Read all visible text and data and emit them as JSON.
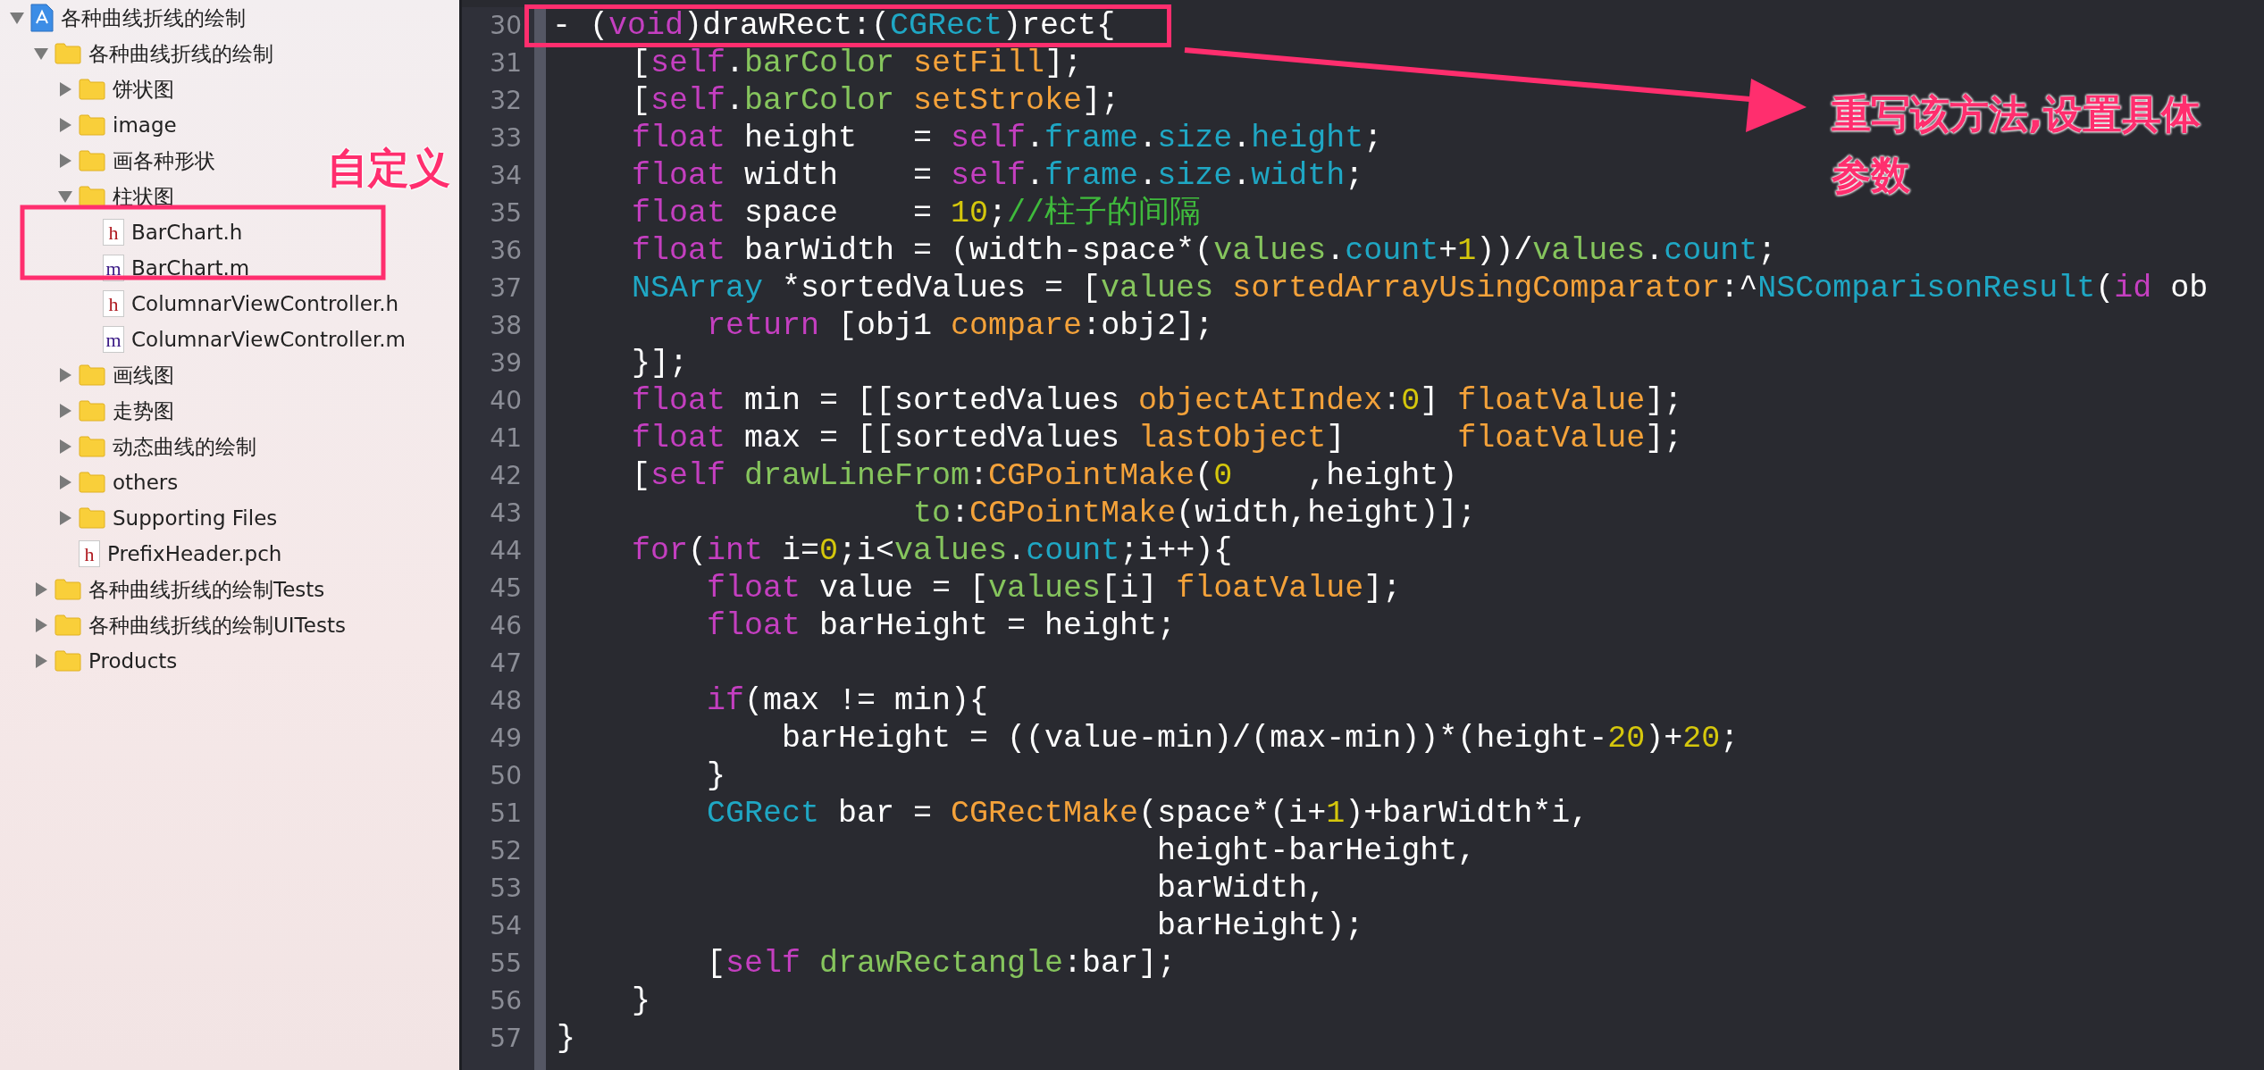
{
  "navigator": {
    "items": [
      {
        "label": "各种曲线折线的绘制",
        "kind": "project",
        "expanded": true,
        "children": [
          {
            "label": "各种曲线折线的绘制",
            "kind": "folder",
            "expanded": true,
            "children": [
              {
                "label": "饼状图",
                "kind": "folder",
                "expanded": false
              },
              {
                "label": "image",
                "kind": "folder",
                "expanded": false
              },
              {
                "label": "画各种形状",
                "kind": "folder",
                "expanded": false
              },
              {
                "label": "柱状图",
                "kind": "folder",
                "expanded": true,
                "children": [
                  {
                    "label": "BarChart.h",
                    "kind": "file",
                    "badge": "h"
                  },
                  {
                    "label": "BarChart.m",
                    "kind": "file",
                    "badge": "m"
                  },
                  {
                    "label": "ColumnarViewController.h",
                    "kind": "file",
                    "badge": "h"
                  },
                  {
                    "label": "ColumnarViewController.m",
                    "kind": "file",
                    "badge": "m"
                  }
                ]
              },
              {
                "label": "画线图",
                "kind": "folder",
                "expanded": false
              },
              {
                "label": "走势图",
                "kind": "folder",
                "expanded": false
              },
              {
                "label": "动态曲线的绘制",
                "kind": "folder",
                "expanded": false
              },
              {
                "label": "others",
                "kind": "folder",
                "expanded": false
              },
              {
                "label": "Supporting Files",
                "kind": "folder",
                "expanded": false
              },
              {
                "label": "PrefixHeader.pch",
                "kind": "file",
                "badge": "h"
              }
            ]
          },
          {
            "label": "各种曲线折线的绘制Tests",
            "kind": "folder",
            "expanded": false
          },
          {
            "label": "各种曲线折线的绘制UITests",
            "kind": "folder",
            "expanded": false
          },
          {
            "label": "Products",
            "kind": "folder",
            "expanded": false
          }
        ]
      }
    ]
  },
  "editor": {
    "lines": [
      {
        "number": "30",
        "highlighted": true,
        "tokens": [
          {
            "text": "- (",
            "kind": "plain"
          },
          {
            "text": "void",
            "kind": "keyword"
          },
          {
            "text": ")drawRect:(",
            "kind": "plain"
          },
          {
            "text": "CGRect",
            "kind": "type"
          },
          {
            "text": ")rect{",
            "kind": "plain"
          }
        ]
      },
      {
        "number": "31",
        "highlighted": false,
        "tokens": [
          {
            "text": "    [",
            "kind": "plain"
          },
          {
            "text": "self",
            "kind": "keyword"
          },
          {
            "text": ".",
            "kind": "plain"
          },
          {
            "text": "barColor",
            "kind": "var"
          },
          {
            "text": " setFill",
            "kind": "method"
          },
          {
            "text": "];",
            "kind": "plain"
          }
        ]
      },
      {
        "number": "32",
        "highlighted": false,
        "tokens": [
          {
            "text": "    [",
            "kind": "plain"
          },
          {
            "text": "self",
            "kind": "keyword"
          },
          {
            "text": ".",
            "kind": "plain"
          },
          {
            "text": "barColor",
            "kind": "var"
          },
          {
            "text": " setStroke",
            "kind": "method"
          },
          {
            "text": "];",
            "kind": "plain"
          }
        ]
      },
      {
        "number": "33",
        "highlighted": false,
        "tokens": [
          {
            "text": "    float",
            "kind": "keyword"
          },
          {
            "text": " height   = ",
            "kind": "plain"
          },
          {
            "text": "self",
            "kind": "keyword"
          },
          {
            "text": ".",
            "kind": "plain"
          },
          {
            "text": "frame",
            "kind": "type"
          },
          {
            "text": ".",
            "kind": "plain"
          },
          {
            "text": "size",
            "kind": "type"
          },
          {
            "text": ".",
            "kind": "plain"
          },
          {
            "text": "height",
            "kind": "type"
          },
          {
            "text": ";",
            "kind": "plain"
          }
        ]
      },
      {
        "number": "34",
        "highlighted": false,
        "tokens": [
          {
            "text": "    float",
            "kind": "keyword"
          },
          {
            "text": " width    = ",
            "kind": "plain"
          },
          {
            "text": "self",
            "kind": "keyword"
          },
          {
            "text": ".",
            "kind": "plain"
          },
          {
            "text": "frame",
            "kind": "type"
          },
          {
            "text": ".",
            "kind": "plain"
          },
          {
            "text": "size",
            "kind": "type"
          },
          {
            "text": ".",
            "kind": "plain"
          },
          {
            "text": "width",
            "kind": "type"
          },
          {
            "text": ";",
            "kind": "plain"
          }
        ]
      },
      {
        "number": "35",
        "highlighted": false,
        "tokens": [
          {
            "text": "    float",
            "kind": "keyword"
          },
          {
            "text": " space    = ",
            "kind": "plain"
          },
          {
            "text": "10",
            "kind": "number"
          },
          {
            "text": ";",
            "kind": "plain"
          },
          {
            "text": "//柱子的间隔",
            "kind": "comment"
          }
        ]
      },
      {
        "number": "36",
        "highlighted": false,
        "tokens": [
          {
            "text": "    float",
            "kind": "keyword"
          },
          {
            "text": " barWidth = (width-space*(",
            "kind": "plain"
          },
          {
            "text": "values",
            "kind": "var"
          },
          {
            "text": ".",
            "kind": "plain"
          },
          {
            "text": "count",
            "kind": "type"
          },
          {
            "text": "+",
            "kind": "plain"
          },
          {
            "text": "1",
            "kind": "number"
          },
          {
            "text": "))/",
            "kind": "plain"
          },
          {
            "text": "values",
            "kind": "var"
          },
          {
            "text": ".",
            "kind": "plain"
          },
          {
            "text": "count",
            "kind": "type"
          },
          {
            "text": ";",
            "kind": "plain"
          }
        ]
      },
      {
        "number": "37",
        "highlighted": false,
        "tokens": [
          {
            "text": "    NSArray",
            "kind": "type"
          },
          {
            "text": " *sortedValues = [",
            "kind": "plain"
          },
          {
            "text": "values",
            "kind": "var"
          },
          {
            "text": " sortedArrayUsingComparator",
            "kind": "method"
          },
          {
            "text": ":^",
            "kind": "plain"
          },
          {
            "text": "NSComparisonResult",
            "kind": "type"
          },
          {
            "text": "(",
            "kind": "plain"
          },
          {
            "text": "id",
            "kind": "keyword"
          },
          {
            "text": " ob",
            "kind": "plain"
          }
        ]
      },
      {
        "number": "38",
        "highlighted": false,
        "tokens": [
          {
            "text": "        return",
            "kind": "keyword"
          },
          {
            "text": " [obj1 ",
            "kind": "plain"
          },
          {
            "text": "compare",
            "kind": "method"
          },
          {
            "text": ":obj2];",
            "kind": "plain"
          }
        ]
      },
      {
        "number": "39",
        "highlighted": false,
        "tokens": [
          {
            "text": "    }];",
            "kind": "plain"
          }
        ]
      },
      {
        "number": "40",
        "highlighted": false,
        "tokens": [
          {
            "text": "    float",
            "kind": "keyword"
          },
          {
            "text": " min = [[sortedValues ",
            "kind": "plain"
          },
          {
            "text": "objectAtIndex",
            "kind": "method"
          },
          {
            "text": ":",
            "kind": "plain"
          },
          {
            "text": "0",
            "kind": "number"
          },
          {
            "text": "] ",
            "kind": "plain"
          },
          {
            "text": "floatValue",
            "kind": "method"
          },
          {
            "text": "];",
            "kind": "plain"
          }
        ]
      },
      {
        "number": "41",
        "highlighted": false,
        "tokens": [
          {
            "text": "    float",
            "kind": "keyword"
          },
          {
            "text": " max = [[sortedValues ",
            "kind": "plain"
          },
          {
            "text": "lastObject",
            "kind": "method"
          },
          {
            "text": "]      ",
            "kind": "plain"
          },
          {
            "text": "floatValue",
            "kind": "method"
          },
          {
            "text": "];",
            "kind": "plain"
          }
        ]
      },
      {
        "number": "42",
        "highlighted": false,
        "tokens": [
          {
            "text": "    [",
            "kind": "plain"
          },
          {
            "text": "self",
            "kind": "keyword"
          },
          {
            "text": " drawLineFrom",
            "kind": "var"
          },
          {
            "text": ":",
            "kind": "plain"
          },
          {
            "text": "CGPointMake",
            "kind": "method"
          },
          {
            "text": "(",
            "kind": "plain"
          },
          {
            "text": "0",
            "kind": "number"
          },
          {
            "text": "    ,height)",
            "kind": "plain"
          }
        ]
      },
      {
        "number": "43",
        "highlighted": false,
        "tokens": [
          {
            "text": "                   to",
            "kind": "var"
          },
          {
            "text": ":",
            "kind": "plain"
          },
          {
            "text": "CGPointMake",
            "kind": "method"
          },
          {
            "text": "(width,height)];",
            "kind": "plain"
          }
        ]
      },
      {
        "number": "44",
        "highlighted": false,
        "tokens": [
          {
            "text": "    for",
            "kind": "keyword"
          },
          {
            "text": "(",
            "kind": "plain"
          },
          {
            "text": "int",
            "kind": "keyword"
          },
          {
            "text": " i=",
            "kind": "plain"
          },
          {
            "text": "0",
            "kind": "number"
          },
          {
            "text": ";i<",
            "kind": "plain"
          },
          {
            "text": "values",
            "kind": "var"
          },
          {
            "text": ".",
            "kind": "plain"
          },
          {
            "text": "count",
            "kind": "type"
          },
          {
            "text": ";i++){",
            "kind": "plain"
          }
        ]
      },
      {
        "number": "45",
        "highlighted": false,
        "tokens": [
          {
            "text": "        float",
            "kind": "keyword"
          },
          {
            "text": " value = [",
            "kind": "plain"
          },
          {
            "text": "values",
            "kind": "var"
          },
          {
            "text": "[i] ",
            "kind": "plain"
          },
          {
            "text": "floatValue",
            "kind": "method"
          },
          {
            "text": "];",
            "kind": "plain"
          }
        ]
      },
      {
        "number": "46",
        "highlighted": false,
        "tokens": [
          {
            "text": "        float",
            "kind": "keyword"
          },
          {
            "text": " barHeight = height;",
            "kind": "plain"
          }
        ]
      },
      {
        "number": "47",
        "highlighted": false
      },
      {
        "number": "48",
        "highlighted": false,
        "tokens": [
          {
            "text": "        if",
            "kind": "keyword"
          },
          {
            "text": "(max != min){",
            "kind": "plain"
          }
        ]
      },
      {
        "number": "49",
        "highlighted": false,
        "tokens": [
          {
            "text": "            barHeight = ((value-min)/(max-min))*(height-",
            "kind": "plain"
          },
          {
            "text": "20",
            "kind": "number"
          },
          {
            "text": ")+",
            "kind": "plain"
          },
          {
            "text": "20",
            "kind": "number"
          },
          {
            "text": ";",
            "kind": "plain"
          }
        ]
      },
      {
        "number": "50",
        "highlighted": false,
        "tokens": [
          {
            "text": "        }",
            "kind": "plain"
          }
        ]
      },
      {
        "number": "51",
        "highlighted": false,
        "tokens": [
          {
            "text": "        CGRect",
            "kind": "type"
          },
          {
            "text": " bar = ",
            "kind": "plain"
          },
          {
            "text": "CGRectMake",
            "kind": "method"
          },
          {
            "text": "(space*(i+",
            "kind": "plain"
          },
          {
            "text": "1",
            "kind": "number"
          },
          {
            "text": ")+barWidth*i,",
            "kind": "plain"
          }
        ]
      },
      {
        "number": "52",
        "highlighted": false,
        "tokens": [
          {
            "text": "                                height-barHeight,",
            "kind": "plain"
          }
        ]
      },
      {
        "number": "53",
        "highlighted": false,
        "tokens": [
          {
            "text": "                                barWidth,",
            "kind": "plain"
          }
        ]
      },
      {
        "number": "54",
        "highlighted": false,
        "tokens": [
          {
            "text": "                                barHeight);",
            "kind": "plain"
          }
        ]
      },
      {
        "number": "55",
        "highlighted": false,
        "tokens": [
          {
            "text": "        [",
            "kind": "plain"
          },
          {
            "text": "self",
            "kind": "keyword"
          },
          {
            "text": " drawRectangle",
            "kind": "var"
          },
          {
            "text": ":bar];",
            "kind": "plain"
          }
        ]
      },
      {
        "number": "56",
        "highlighted": false,
        "tokens": [
          {
            "text": "    }",
            "kind": "plain"
          }
        ]
      },
      {
        "number": "57",
        "highlighted": false,
        "tokens": [
          {
            "text": "}",
            "kind": "plain"
          }
        ]
      }
    ]
  },
  "annotations": [
    {
      "kind": "label",
      "text": "自定义"
    },
    {
      "kind": "callout",
      "text": "重写该方法,设置具体参数"
    }
  ]
}
